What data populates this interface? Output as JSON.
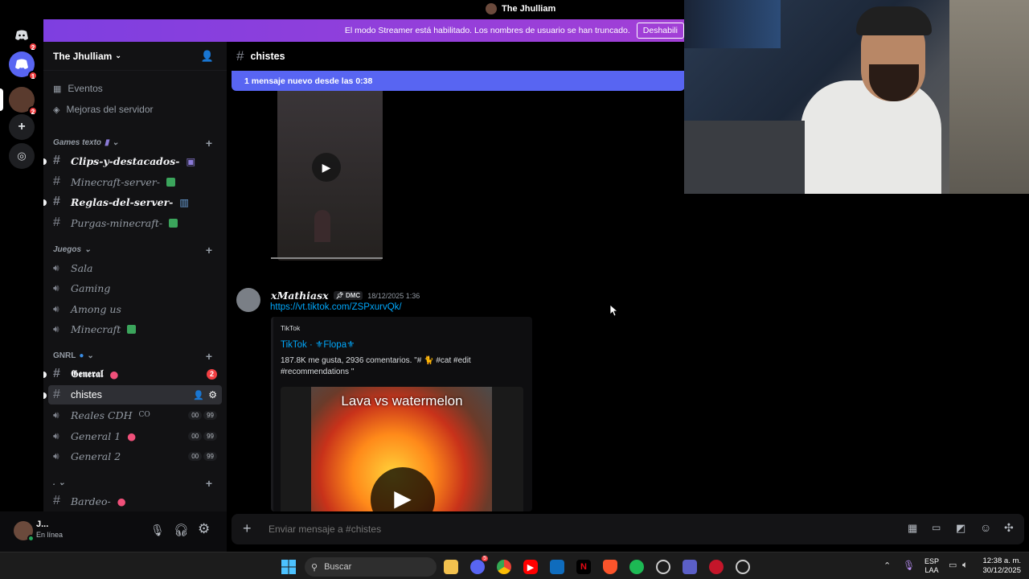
{
  "window": {
    "title": "The Jhulliam"
  },
  "banner": {
    "text": "El modo Streamer está habilitado. Los nombres de usuario se han truncado.",
    "button": "Deshabili"
  },
  "rail": {
    "badges": [
      "2",
      "1",
      "2"
    ]
  },
  "server": {
    "name": "The Jhulliam",
    "top_items": [
      "Eventos",
      "Mejoras del servidor"
    ],
    "categories": [
      {
        "name": "Games texto",
        "channels": [
          {
            "name": "Clips-y-destacados-",
            "bold": true
          },
          {
            "name": "Minecraft-server-",
            "bold": false
          },
          {
            "name": "Reglas-del-server-",
            "bold": true
          },
          {
            "name": "Purgas-minecraft-",
            "bold": false
          }
        ]
      },
      {
        "name": "Juegos",
        "channels": [
          {
            "name": "Sala"
          },
          {
            "name": "Gaming"
          },
          {
            "name": "Among us"
          },
          {
            "name": "Minecraft"
          }
        ]
      },
      {
        "name": "GNRL",
        "channels": [
          {
            "name": "𝕲𝖊𝖓𝖊𝖗𝖆𝖑",
            "badge": "2"
          },
          {
            "name": "chistes"
          },
          {
            "name": "Reales CDH",
            "suffix": "CO",
            "counts": [
              "00",
              "99"
            ]
          },
          {
            "name": "General 1",
            "counts": [
              "00",
              "99"
            ]
          },
          {
            "name": "General 2",
            "counts": [
              "00",
              "99"
            ]
          }
        ]
      },
      {
        "name": ".",
        "channels": [
          {
            "name": "Bardeo-"
          }
        ]
      }
    ]
  },
  "user": {
    "name": "J...",
    "status": "En línea"
  },
  "channel": {
    "name": "chistes"
  },
  "new_messages": "1 mensaje nuevo desde las 0:38",
  "message": {
    "author": "xMathiasx",
    "tag": "DMC",
    "timestamp": "18/12/2025 1:36",
    "link": "https://vt.tiktok.com/ZSPxurvQk/",
    "embed": {
      "provider": "TikTok",
      "title": "TikTok · ⚜Flopa⚜",
      "description": "187.8K me gusta, 2936 comentarios. \"# 🐈 #cat #edit #recommendations \"",
      "video_caption": "Lava vs watermelon"
    }
  },
  "composer": {
    "placeholder": "Enviar mensaje a #chistes"
  },
  "taskbar": {
    "search": "Buscar",
    "lang1": "ESP",
    "lang2": "LAA",
    "time": "12:38 a. m.",
    "date": "30/12/2025",
    "discord_badge": "5"
  }
}
